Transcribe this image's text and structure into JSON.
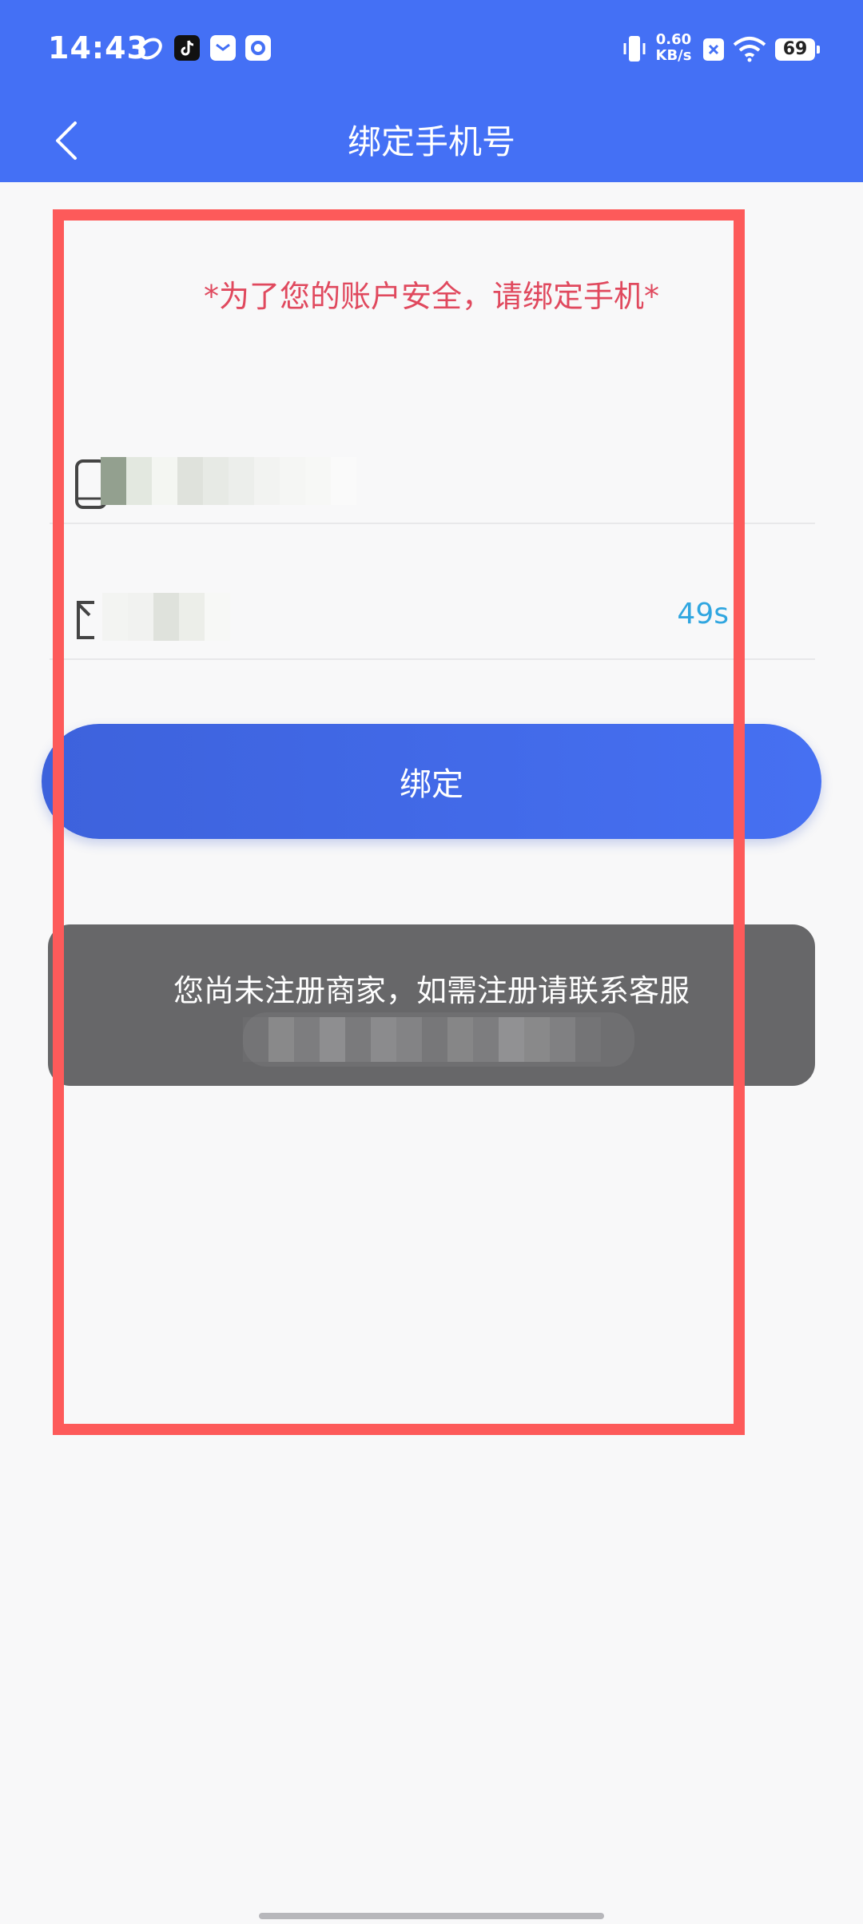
{
  "status_bar": {
    "time": "14:43",
    "net_rate_value": "0.60",
    "net_rate_unit": "KB/s",
    "battery_level": "69",
    "icons": [
      "link-icon",
      "tiktok-icon",
      "mail-icon",
      "camera-app-icon",
      "vibrate-icon",
      "close-notification-icon",
      "wifi-icon",
      "battery-icon"
    ]
  },
  "header": {
    "title": "绑定手机号",
    "back_icon": "chevron-left-icon",
    "background": "#4470f5"
  },
  "notice": {
    "text": "*为了您的账户安全，请绑定手机*",
    "color": "#e0495e"
  },
  "form": {
    "phone_field": {
      "icon": "phone-icon",
      "value": ""
    },
    "code_field": {
      "icon": "message-icon",
      "value": "",
      "countdown": "49s"
    },
    "bind_label": "绑定"
  },
  "toast": {
    "message": "您尚未注册商家，如需注册请联系客服",
    "background": "#5a5a5c"
  },
  "highlight": {
    "color": "#fd5a5a"
  }
}
